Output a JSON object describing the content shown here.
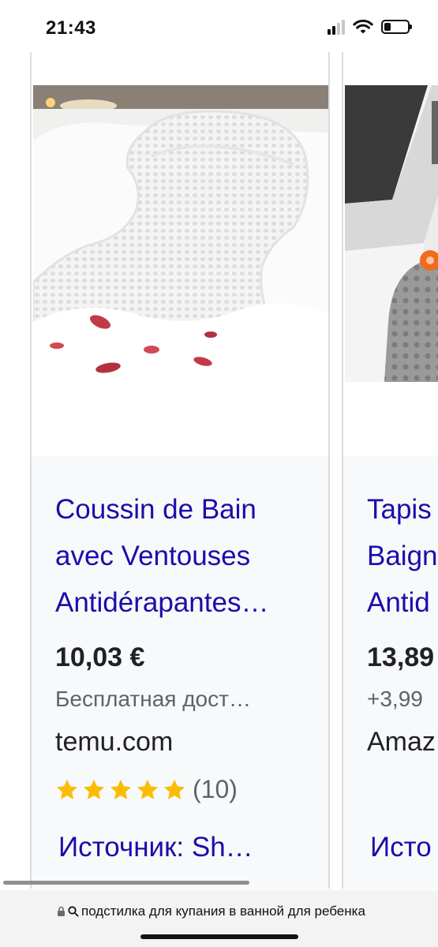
{
  "status_bar": {
    "time": "21:43",
    "battery_level": 0.3
  },
  "cards": [
    {
      "title_lines": [
        "Coussin de Bain",
        "avec Ventouses",
        "Antidérapantes…"
      ],
      "price": "10,03 €",
      "shipping": "Бесплатная дост…",
      "store": "temu.com",
      "rating_stars": 5,
      "rating_count": "(10)",
      "source": "Источник: Sh…"
    },
    {
      "title_lines": [
        "Tapis",
        "Baign",
        "Antid"
      ],
      "price": "13,89",
      "shipping": "+3,99",
      "store": "Amaz",
      "source": "Исто"
    }
  ],
  "address_bar": {
    "text": "подстилка для купания в ванной для ребенка"
  },
  "colors": {
    "link": "#1a0dab",
    "star": "#fbbc04",
    "info_bg": "#f8f9fa"
  }
}
